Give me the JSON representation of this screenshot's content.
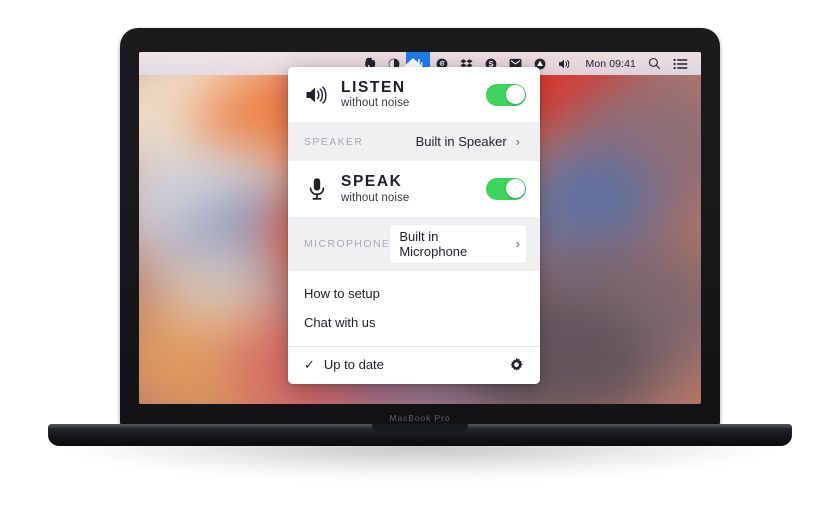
{
  "device": {
    "model_label": "MacBook Pro"
  },
  "menubar": {
    "icons": [
      {
        "name": "evernote-icon",
        "glyph": "elephant"
      },
      {
        "name": "dark-circle-icon",
        "glyph": "contrast"
      },
      {
        "name": "krisp-app-icon",
        "glyph": "equalizer",
        "active": true
      },
      {
        "name": "spiral-icon",
        "glyph": "spiral"
      },
      {
        "name": "dropbox-icon",
        "glyph": "dropbox"
      },
      {
        "name": "skype-icon",
        "glyph": "skype"
      },
      {
        "name": "gmail-icon",
        "glyph": "envelope"
      },
      {
        "name": "google-drive-icon",
        "glyph": "triangle"
      },
      {
        "name": "volume-icon",
        "glyph": "speaker"
      }
    ],
    "clock": "Mon 09:41",
    "search_icon": "search-icon",
    "controlcenter_icon": "list-icon",
    "accent_active": "#1f7cf0"
  },
  "popover": {
    "listen": {
      "icon": "speaker-icon",
      "title": "LISTEN",
      "subtitle": "without noise",
      "toggle_on": true,
      "toggle_color": "#3ed45e"
    },
    "speaker": {
      "label": "SPEAKER",
      "value": "Built in Speaker",
      "chevron": "›",
      "highlighted": false
    },
    "speak": {
      "icon": "microphone-icon",
      "title": "SPEAK",
      "subtitle": "without noise",
      "toggle_on": true,
      "toggle_color": "#3ed45e"
    },
    "microphone": {
      "label": "MICROPHONE",
      "value": "Built in Microphone",
      "chevron": "›",
      "highlighted": true
    },
    "links": [
      {
        "label": "How to setup"
      },
      {
        "label": "Chat with us"
      }
    ],
    "footer": {
      "check": "✓",
      "status": "Up to date",
      "settings_icon": "gear-icon"
    }
  }
}
